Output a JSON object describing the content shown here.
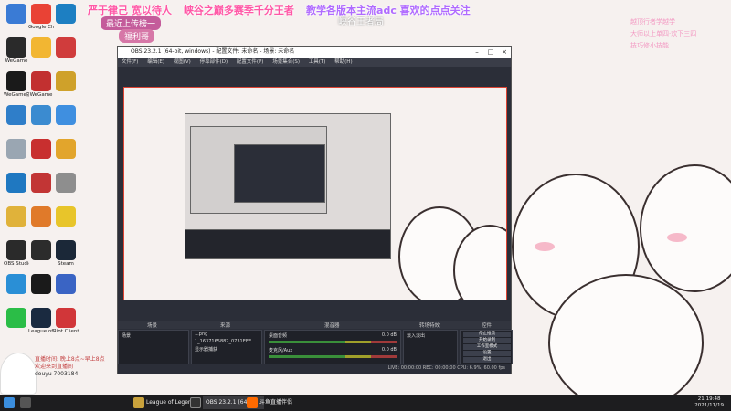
{
  "overlay": {
    "top_left": "严于律己 宽以待人",
    "top_mid": "峡谷之巅多赛季千分王者",
    "top_right": "教学各版本主流adc 喜欢的点点关注",
    "sub_1": "最近上传榜一",
    "sub_2": "福利哥",
    "mid_banner": "峡谷王者局",
    "right_notes": [
      "越顶行者学越学",
      "大师以上单四·欢下三四",
      "技巧修小技能"
    ]
  },
  "desktop_icons": [
    {
      "label": "",
      "color": "#3a7bd5"
    },
    {
      "label": "Google Chrome",
      "color": "#e94235"
    },
    {
      "label": "",
      "color": "#1d7fc2"
    },
    {
      "label": "WeGame",
      "color": "#2a2a2a"
    },
    {
      "label": "",
      "color": "#f2b632"
    },
    {
      "label": "",
      "color": "#d03c3c"
    },
    {
      "label": "WeGame版",
      "color": "#1a1a1a"
    },
    {
      "label": "WeGame",
      "color": "#c23030"
    },
    {
      "label": "",
      "color": "#cfa12a"
    },
    {
      "label": "",
      "color": "#2f7ec9"
    },
    {
      "label": "",
      "color": "#3b8bd0"
    },
    {
      "label": "",
      "color": "#3f8fe0"
    },
    {
      "label": "",
      "color": "#9aa6b2"
    },
    {
      "label": "",
      "color": "#c82f2f"
    },
    {
      "label": "",
      "color": "#e2a52c"
    },
    {
      "label": "",
      "color": "#1f78c1"
    },
    {
      "label": "",
      "color": "#c23535"
    },
    {
      "label": "",
      "color": "#8e8e8e"
    },
    {
      "label": "",
      "color": "#e0b23a"
    },
    {
      "label": "",
      "color": "#e07a2a"
    },
    {
      "label": "",
      "color": "#e8c52a"
    },
    {
      "label": "OBS Studio",
      "color": "#2a2a2a"
    },
    {
      "label": "",
      "color": "#2c2c2c"
    },
    {
      "label": "Steam",
      "color": "#1b2838"
    },
    {
      "label": "",
      "color": "#2a8fd6"
    },
    {
      "label": "",
      "color": "#1a1a1a"
    },
    {
      "label": "",
      "color": "#3a64c4"
    },
    {
      "label": "",
      "color": "#2bbd47"
    },
    {
      "label": "League of Legends",
      "color": "#1a2a40"
    },
    {
      "label": "Riot Client",
      "color": "#d13639"
    }
  ],
  "obs": {
    "title": "OBS 23.2.1 (64-bit, windows) - 配置文件: 未命名 - 场景: 未命名",
    "menu": [
      "文件(F)",
      "编辑(E)",
      "视图(V)",
      "停靠部件(D)",
      "配置文件(P)",
      "场景集合(S)",
      "工具(T)",
      "帮助(H)"
    ],
    "docks": [
      "场景",
      "来源",
      "混音器",
      "转场特效",
      "控件"
    ],
    "scene_items": [
      "场景"
    ],
    "source_items": [
      "1.png",
      "1_1637165882_0731EEE",
      "显示器捕获"
    ],
    "mixer": [
      {
        "name": "桌面音频",
        "level": "0.0 dB"
      },
      {
        "name": "麦克风/Aux",
        "level": "0.0 dB"
      }
    ],
    "transition": "淡入淡出",
    "controls": [
      "停止推流",
      "开始录制",
      "工作室模式",
      "设置",
      "退出"
    ],
    "status": "LIVE: 00:00:00   REC: 00:00:00   CPU: 6.9%, 60.00 fps"
  },
  "chat": {
    "line1": "直播时间: 晚上8点~早上8点",
    "line2": "欢迎来到直播间",
    "uid_label": "douyu 7003184"
  },
  "taskbar": {
    "items": [
      "League of Legends",
      "OBS 23.2.1 (64-bit...",
      "斗鱼直播伴侣"
    ],
    "time": "21:19:48",
    "date": "2021/11/19"
  },
  "colors": {
    "accent_pink": "#ff58a6",
    "obs_bg": "#2b2e38",
    "taskbar_bg": "#1d1d1f"
  }
}
